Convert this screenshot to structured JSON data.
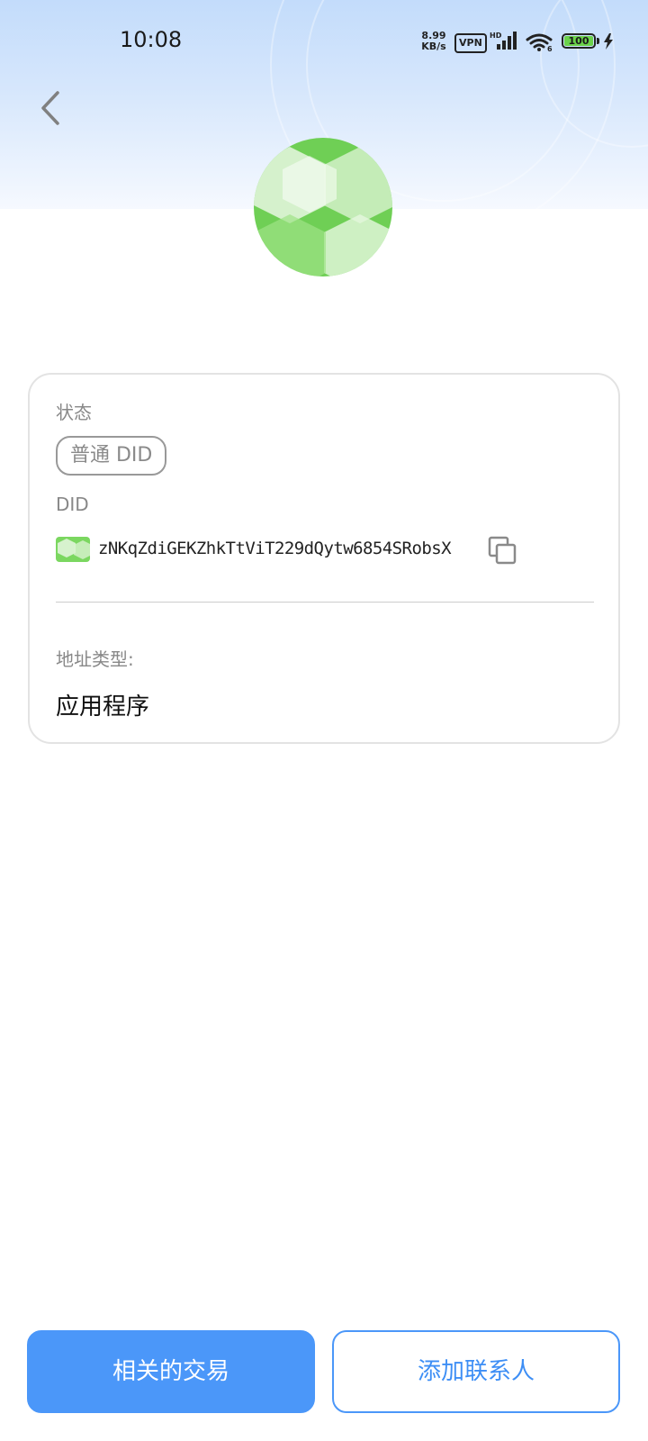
{
  "status_bar": {
    "time": "10:08",
    "net_speed_value": "8.99",
    "net_speed_unit": "KB/s",
    "vpn": "VPN",
    "signal_label": "HD",
    "battery_level": "100"
  },
  "icons": {
    "back": "chevron-left-icon",
    "copy": "copy-icon",
    "signal": "signal-icon",
    "wifi": "wifi-icon",
    "charging": "bolt-icon"
  },
  "card": {
    "status_label": "状态",
    "status_value": "普通 DID",
    "did_label": "DID",
    "did_value": "zNKqZdiGEKZhkTtViT229dQytw6854SRobsX",
    "address_type_label": "地址类型:",
    "address_type_value": "应用程序"
  },
  "actions": {
    "related_transactions": "相关的交易",
    "add_contact": "添加联系人"
  },
  "colors": {
    "primary": "#4b97f9",
    "header_gradient_top": "#c3dcfb",
    "avatar_green": "#6fcf55",
    "border": "#e3e3e3"
  }
}
